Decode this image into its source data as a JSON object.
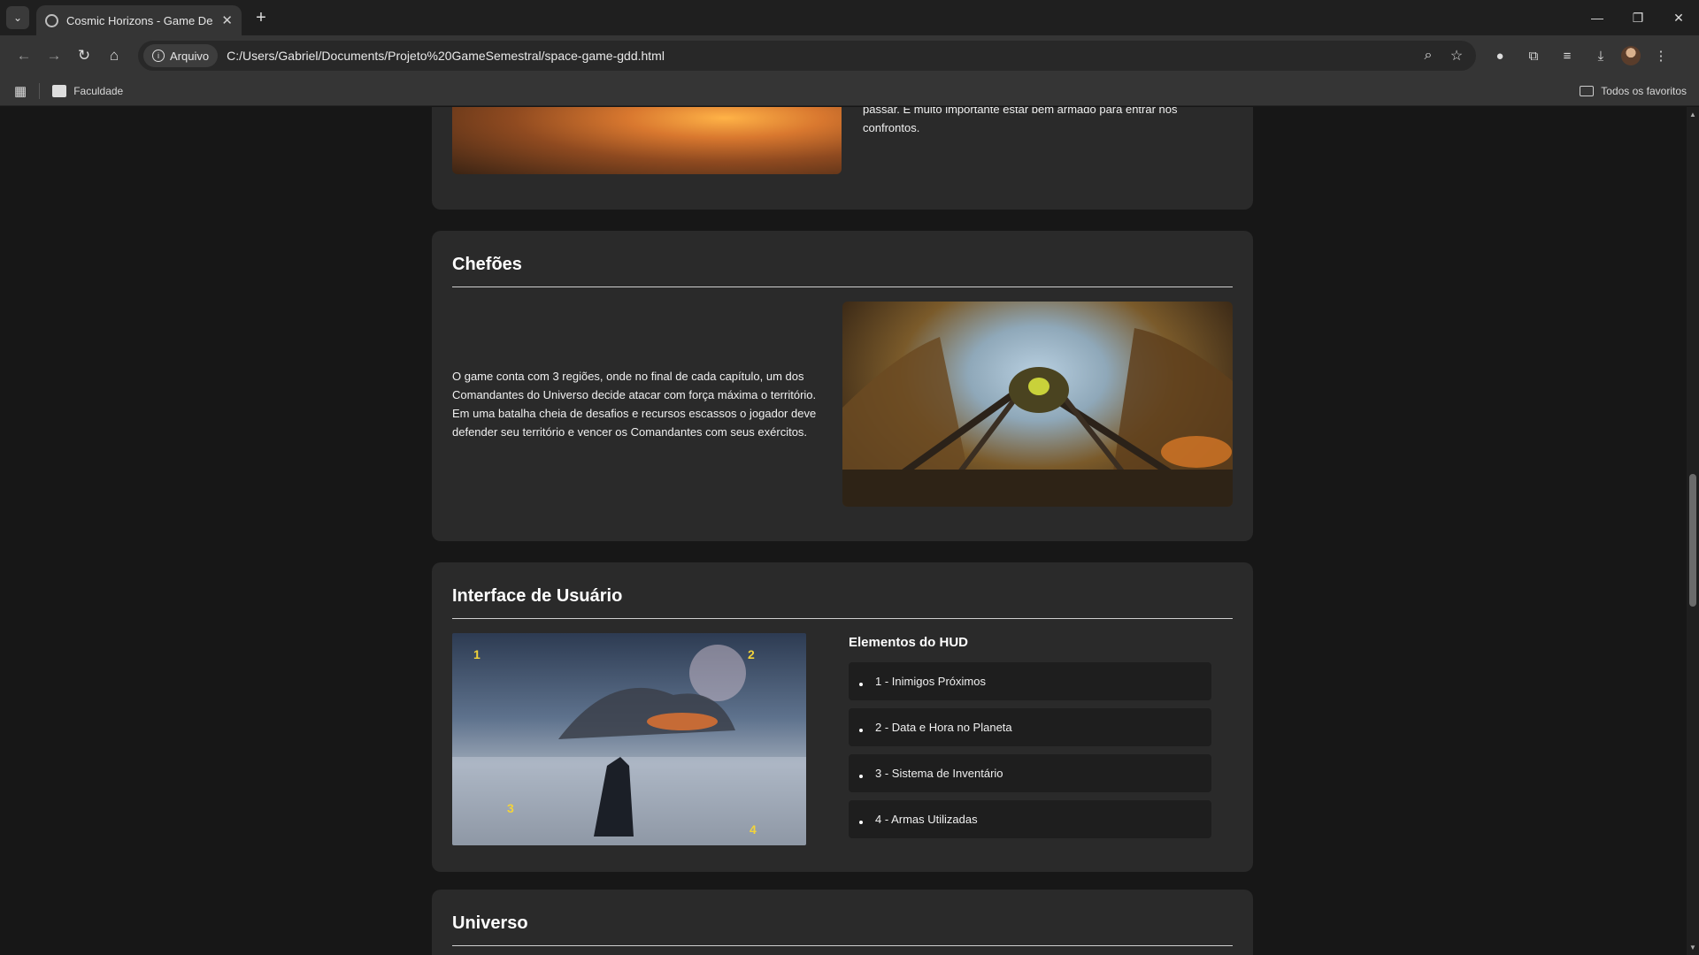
{
  "browser": {
    "tab_title": "Cosmic Horizons - Game Desig",
    "address_chip": "Arquivo",
    "url": "C:/Users/Gabriel/Documents/Projeto%20GameSemestral/space-game-gdd.html",
    "bookmark_faculdade": "Faculdade",
    "bookmark_all": "Todos os favoritos"
  },
  "page": {
    "top_card": {
      "text_line1": "passar. É muito importante estar bem armado para entrar nos",
      "text_line2": "confrontos."
    },
    "bosses": {
      "title": "Chefões",
      "text": "O game conta com 3 regiões, onde no final de cada capítulo, um dos Comandantes do Universo decide atacar com força máxima o território. Em uma batalha cheia de desafios e recursos escassos o jogador deve defender seu território e vencer os Comandantes com seus exércitos."
    },
    "ui": {
      "title": "Interface de Usuário",
      "hud_title": "Elementos do HUD",
      "hud_markers": [
        "1",
        "2",
        "3",
        "4"
      ],
      "hud_items": [
        "1 - Inimigos Próximos",
        "2 - Data e Hora no Planeta",
        "3 - Sistema de Inventário",
        "4 - Armas Utilizadas"
      ]
    },
    "universe": {
      "title": "Universo"
    }
  }
}
